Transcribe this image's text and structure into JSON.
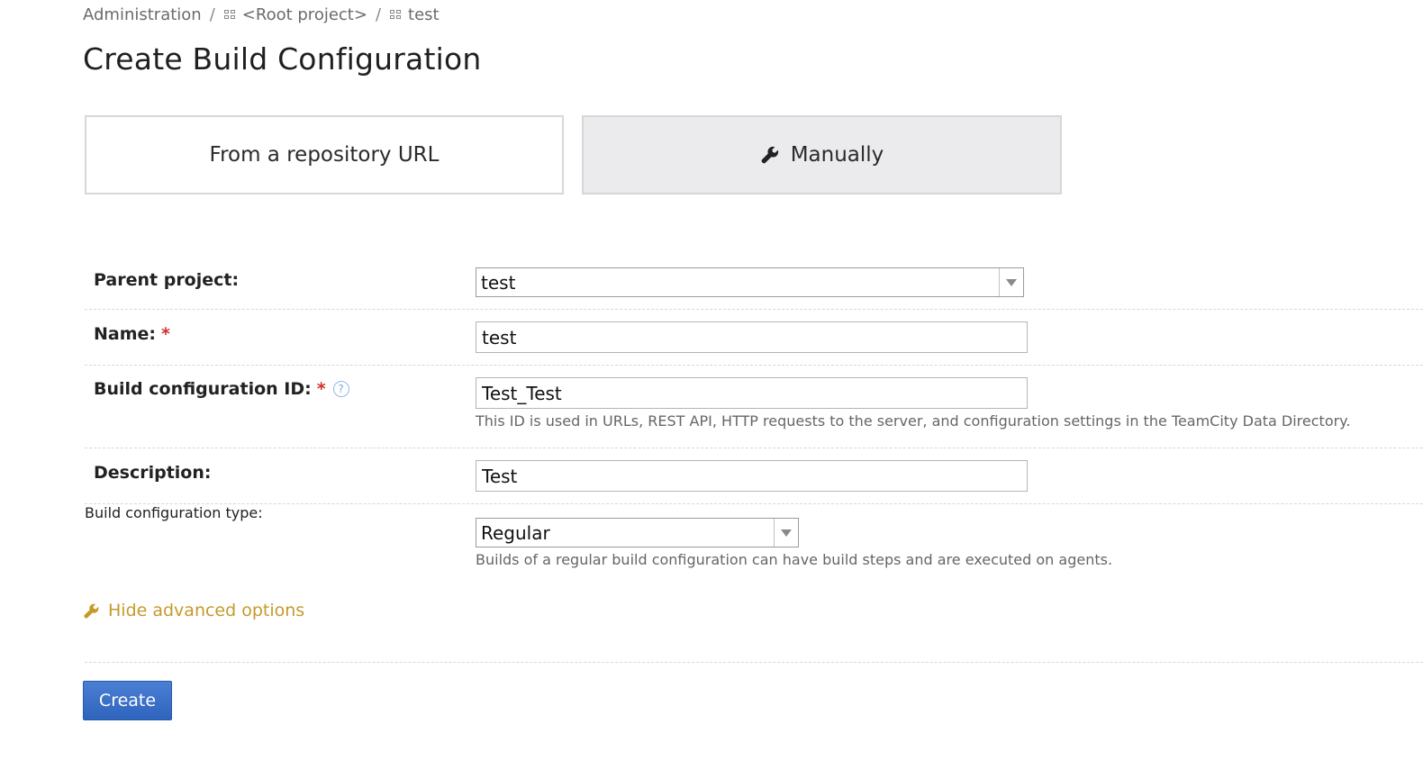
{
  "breadcrumb": {
    "items": [
      {
        "label": "Administration"
      },
      {
        "label": "<Root project>",
        "icon": "project-icon"
      },
      {
        "label": "test",
        "icon": "project-icon"
      }
    ],
    "separator": "/"
  },
  "page": {
    "title": "Create Build Configuration"
  },
  "mode_tabs": {
    "from_url": {
      "label": "From a repository URL",
      "selected": false
    },
    "manually": {
      "label": "Manually",
      "icon": "wrench-icon",
      "selected": true
    }
  },
  "form": {
    "parent_project": {
      "label": "Parent project:",
      "value": "test"
    },
    "name": {
      "label": "Name:",
      "required_mark": "*",
      "value": "test"
    },
    "build_config_id": {
      "label": "Build configuration ID:",
      "required_mark": "*",
      "help_icon": "question-circle-icon",
      "help_glyph": "?",
      "value": "Test_Test",
      "hint": "This ID is used in URLs, REST API, HTTP requests to the server, and configuration settings in the TeamCity Data Directory."
    },
    "description": {
      "label": "Description:",
      "value": "Test"
    },
    "build_config_type": {
      "label": "Build configuration type:",
      "value": "Regular",
      "hint": "Builds of a regular build configuration can have build steps and are executed on agents."
    }
  },
  "advanced": {
    "label": "Hide advanced options",
    "icon": "wrench-icon"
  },
  "actions": {
    "create_label": "Create"
  },
  "colors": {
    "accent_link": "#c59a2a",
    "primary_button": "#3a6fca",
    "required": "#d0312d",
    "help": "#7aa9de"
  }
}
